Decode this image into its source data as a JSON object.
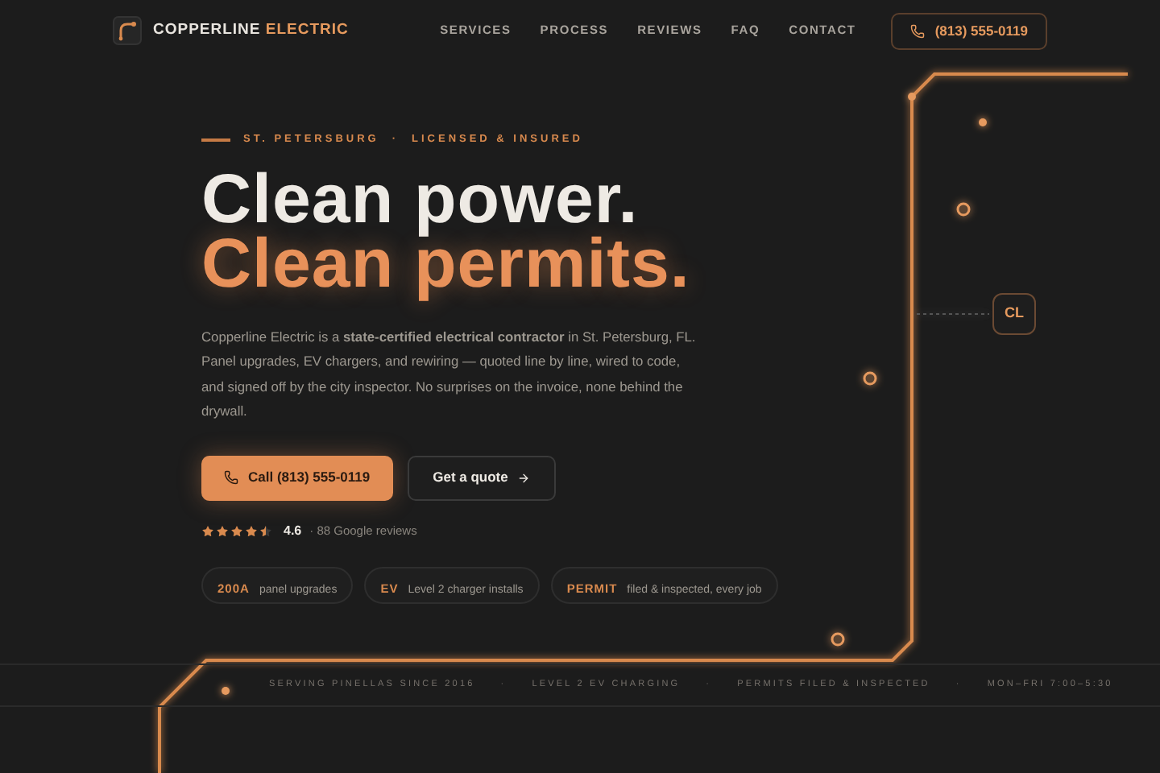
{
  "header": {
    "brand": {
      "first": "COPPERLINE",
      "second": "ELECTRIC"
    },
    "nav": [
      "SERVICES",
      "PROCESS",
      "REVIEWS",
      "FAQ",
      "CONTACT"
    ],
    "phone": "(813) 555-0119"
  },
  "hero": {
    "eyebrow": [
      "ST. PETERSBURG",
      "·",
      "LICENSED & INSURED"
    ],
    "headline": [
      "Clean power.",
      "Clean permits."
    ],
    "body": "Copperline Electric is a **state-certified electrical contractor** in St. Petersburg, FL. Panel upgrades, EV chargers, and rewiring — quoted line by line, wired to code, and signed off by the city inspector. No surprises on the invoice, none behind the drywall.",
    "buttons": [
      {
        "label": "Call (813) 555-0119",
        "kind": "primary"
      },
      {
        "label": "Get a quote",
        "kind": "secondary"
      }
    ],
    "rating": {
      "stars": 4.5,
      "score": "4.6",
      "count": "· 88 Google reviews"
    },
    "chips": [
      {
        "tag": "200A",
        "text": "panel upgrades"
      },
      {
        "tag": "EV",
        "text": "Level 2 charger installs"
      },
      {
        "tag": "PERMIT",
        "text": "filed & inspected, every job"
      }
    ]
  },
  "badge": "CL",
  "ticker": [
    "SERVING PINELLAS SINCE 2016",
    "·",
    "LEVEL 2 EV CHARGING",
    "·",
    "PERMITS FILED & INSPECTED",
    "·",
    "MON–FRI 7:00–5:30"
  ]
}
